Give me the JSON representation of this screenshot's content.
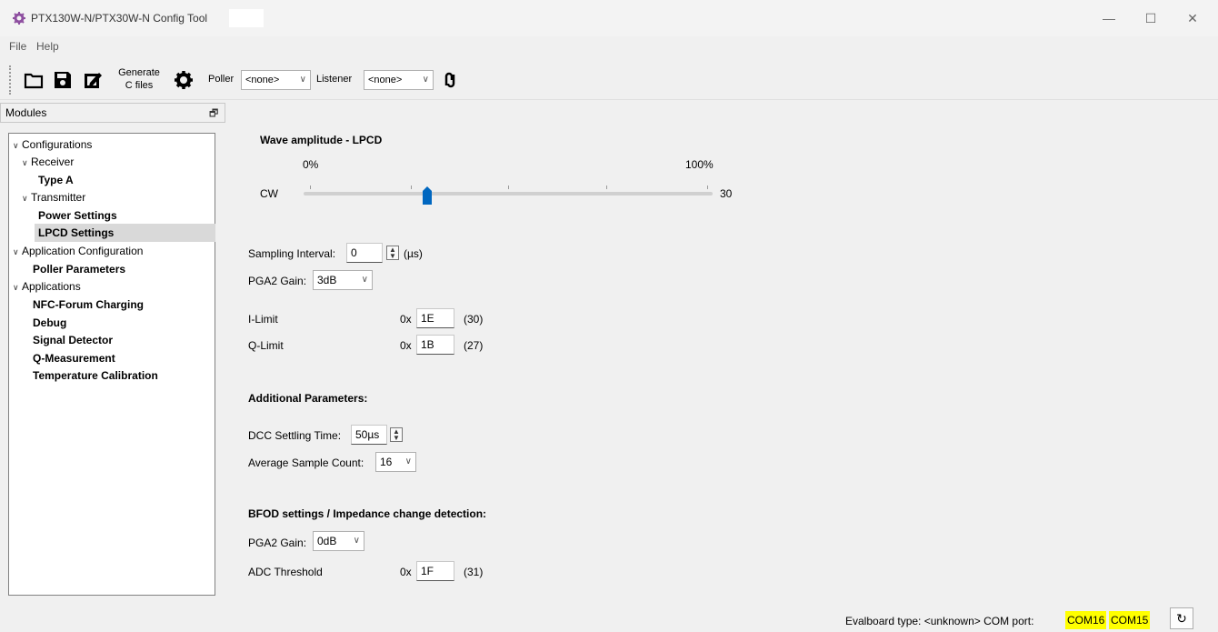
{
  "window": {
    "title": "PTX130W-N/PTX30W-N Config Tool",
    "controls": {
      "minimize": "—",
      "maximize": "☐",
      "close": "✕"
    }
  },
  "menu": {
    "items": [
      "File",
      "Help"
    ]
  },
  "toolbar": {
    "generate_line1": "Generate",
    "generate_line2": "C files",
    "poller_label": "Poller",
    "poller_value": "<none>",
    "listener_label": "Listener",
    "listener_value": "<none>",
    "icons": [
      "open-folder-icon",
      "save-icon",
      "save-as-icon",
      "settings-gear-icon",
      "swap-icon"
    ]
  },
  "modules": {
    "title": "Modules",
    "float_icon": "🗗",
    "tree": [
      {
        "label": "Configurations",
        "level": 0,
        "expanded": true,
        "bold": false
      },
      {
        "label": "Receiver",
        "level": 1,
        "expanded": true,
        "bold": false
      },
      {
        "label": "Type A",
        "level": 2,
        "bold": true
      },
      {
        "label": "Transmitter",
        "level": 1,
        "expanded": true,
        "bold": false
      },
      {
        "label": "Power Settings",
        "level": 2,
        "bold": true
      },
      {
        "label": "LPCD Settings",
        "level": 2,
        "bold": true,
        "selected": true
      },
      {
        "label": "Application Configuration",
        "level": 0,
        "expanded": true,
        "bold": false
      },
      {
        "label": "Poller Parameters",
        "level": 1,
        "bold": true
      },
      {
        "label": "Applications",
        "level": 0,
        "expanded": true,
        "bold": false
      },
      {
        "label": "NFC-Forum Charging",
        "level": 1,
        "bold": true
      },
      {
        "label": "Debug",
        "level": 1,
        "bold": true
      },
      {
        "label": "Signal Detector",
        "level": 1,
        "bold": true
      },
      {
        "label": "Q-Measurement",
        "level": 1,
        "bold": true
      },
      {
        "label": "Temperature Calibration",
        "level": 1,
        "bold": true
      }
    ]
  },
  "lpcd": {
    "wave_title": "Wave amplitude - LPCD",
    "slider_min_label": "0%",
    "slider_max_label": "100%",
    "slider_row_label": "CW",
    "slider_value": "30",
    "slider_fraction": 0.3,
    "sampling_label": "Sampling Interval:",
    "sampling_value": "0",
    "sampling_unit": "(µs)",
    "pga2_label": "PGA2 Gain:",
    "pga2_value": "3dB",
    "ilimit_label": "I-Limit",
    "ilimit_prefix": "0x",
    "ilimit_value": "1E",
    "ilimit_dec": "(30)",
    "qlimit_label": "Q-Limit",
    "qlimit_prefix": "0x",
    "qlimit_value": "1B",
    "qlimit_dec": "(27)"
  },
  "additional": {
    "title": "Additional Parameters:",
    "dcc_label": "DCC Settling Time:",
    "dcc_value": "50µs",
    "avg_label": "Average Sample Count:",
    "avg_value": "16"
  },
  "bfod": {
    "title": "BFOD settings / Impedance change detection:",
    "pga2_label": "PGA2 Gain:",
    "pga2_value": "0dB",
    "adc_label": "ADC Threshold",
    "adc_prefix": "0x",
    "adc_value": "1F",
    "adc_dec": "(31)"
  },
  "status": {
    "text": "Evalboard type: <unknown> COM port:",
    "com1": "COM16",
    "com2": "COM15",
    "refresh_icon": "↻"
  },
  "colors": {
    "accent": "#0067c0",
    "highlight": "#ffff00",
    "app_icon": "#8e4fa0"
  }
}
